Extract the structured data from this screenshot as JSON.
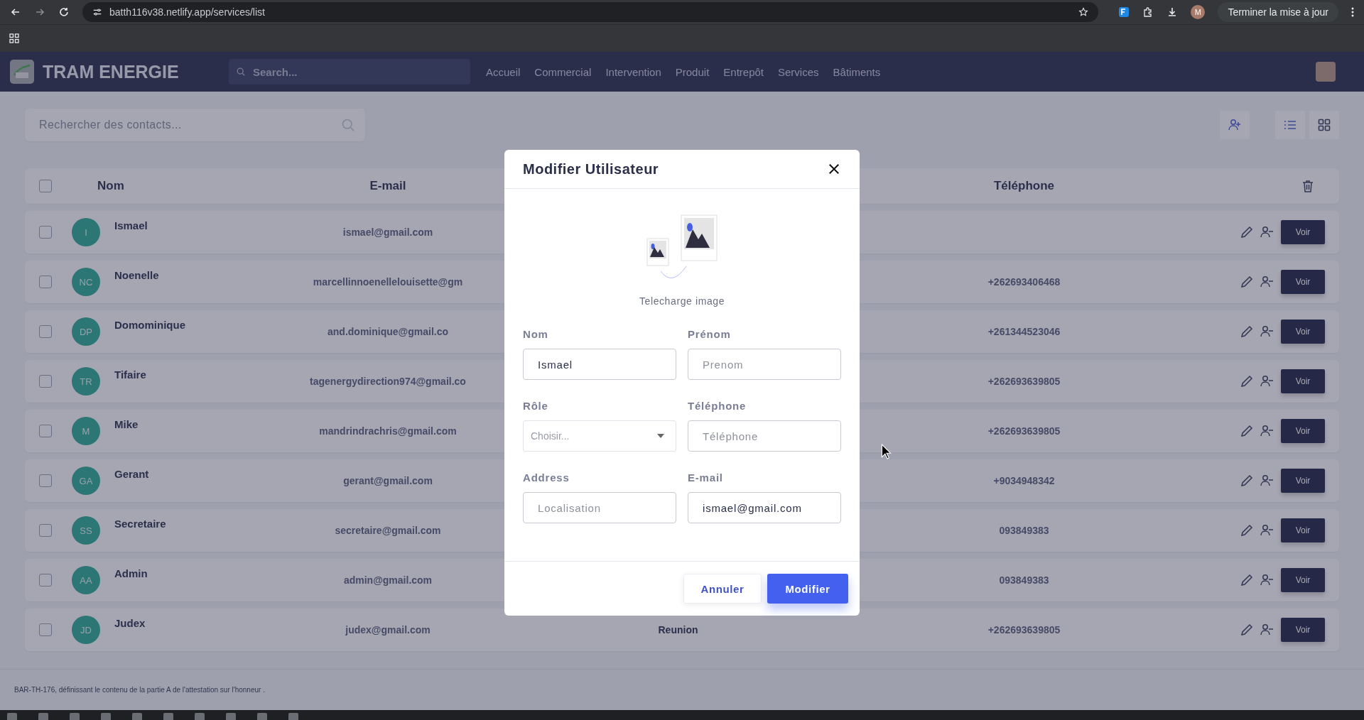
{
  "browser": {
    "url": "batth116v38.netlify.app/services/list",
    "profile_initial": "M",
    "update_button": "Terminer la mise à jour"
  },
  "header": {
    "brand": "TRAM ENERGIE",
    "search_placeholder": "Search...",
    "nav": [
      "Accueil",
      "Commercial",
      "Intervention",
      "Produit",
      "Entrepôt",
      "Services",
      "Bâtiments"
    ]
  },
  "contacts": {
    "search_placeholder": "Rechercher des contacts..."
  },
  "table": {
    "columns": [
      "Nom",
      "E-mail",
      "Téléphone"
    ],
    "all_checked": false,
    "rows": [
      {
        "initials": "I",
        "name": "Ismael",
        "email": "ismael@gmail.com",
        "column_3": "",
        "phone": "",
        "action": "Voir",
        "checked": false
      },
      {
        "initials": "NC",
        "name": "Noenelle",
        "email": "marcellinnoenellelouisette@gm",
        "column_3": "",
        "phone": "+262693406468",
        "action": "Voir",
        "checked": false
      },
      {
        "initials": "DP",
        "name": "Domominique",
        "email": "and.dominique@gmail.co",
        "column_3": "",
        "phone": "+261344523046",
        "action": "Voir",
        "checked": false
      },
      {
        "initials": "TR",
        "name": "Tifaire",
        "email": "tagenergydirection974@gmail.co",
        "column_3": "",
        "phone": "+262693639805",
        "action": "Voir",
        "checked": false
      },
      {
        "initials": "M",
        "name": "Mike",
        "email": "mandrindrachris@gmail.com",
        "column_3": "",
        "phone": "+262693639805",
        "action": "Voir",
        "checked": false
      },
      {
        "initials": "GA",
        "name": "Gerant",
        "email": "gerant@gmail.com",
        "column_3": "",
        "phone": "+9034948342",
        "action": "Voir",
        "checked": false
      },
      {
        "initials": "SS",
        "name": "Secretaire",
        "email": "secretaire@gmail.com",
        "column_3": "",
        "phone": "093849383",
        "action": "Voir",
        "checked": false
      },
      {
        "initials": "AA",
        "name": "Admin",
        "email": "admin@gmail.com",
        "column_3": "",
        "phone": "093849383",
        "action": "Voir",
        "checked": false
      },
      {
        "initials": "JD",
        "name": "Judex",
        "email": "judex@gmail.com",
        "column_3": "Reunion",
        "phone": "+262693639805",
        "action": "Voir",
        "checked": false
      }
    ]
  },
  "footer": {
    "text": "BAR-TH-176, définissant le contenu de la partie A de l'attestation sur l'honneur ."
  },
  "modal": {
    "title": "Modifier Utilisateur",
    "upload_label": "Telecharge image",
    "fields": [
      {
        "label": "Nom",
        "kind": "text",
        "value": "Ismael"
      },
      {
        "label": "Prénom",
        "kind": "text",
        "placeholder": "Prenom"
      },
      {
        "label": "Rôle",
        "kind": "select",
        "placeholder": "Choisir..."
      },
      {
        "label": "Téléphone",
        "kind": "text",
        "placeholder": "Téléphone"
      },
      {
        "label": "Address",
        "kind": "text",
        "placeholder": "Localisation"
      },
      {
        "label": "E-mail",
        "kind": "text",
        "value": "ismael@gmail.com"
      }
    ],
    "buttons": [
      {
        "label": "Annuler",
        "kind": "secondary"
      },
      {
        "label": "Modifier",
        "kind": "primary"
      }
    ]
  }
}
